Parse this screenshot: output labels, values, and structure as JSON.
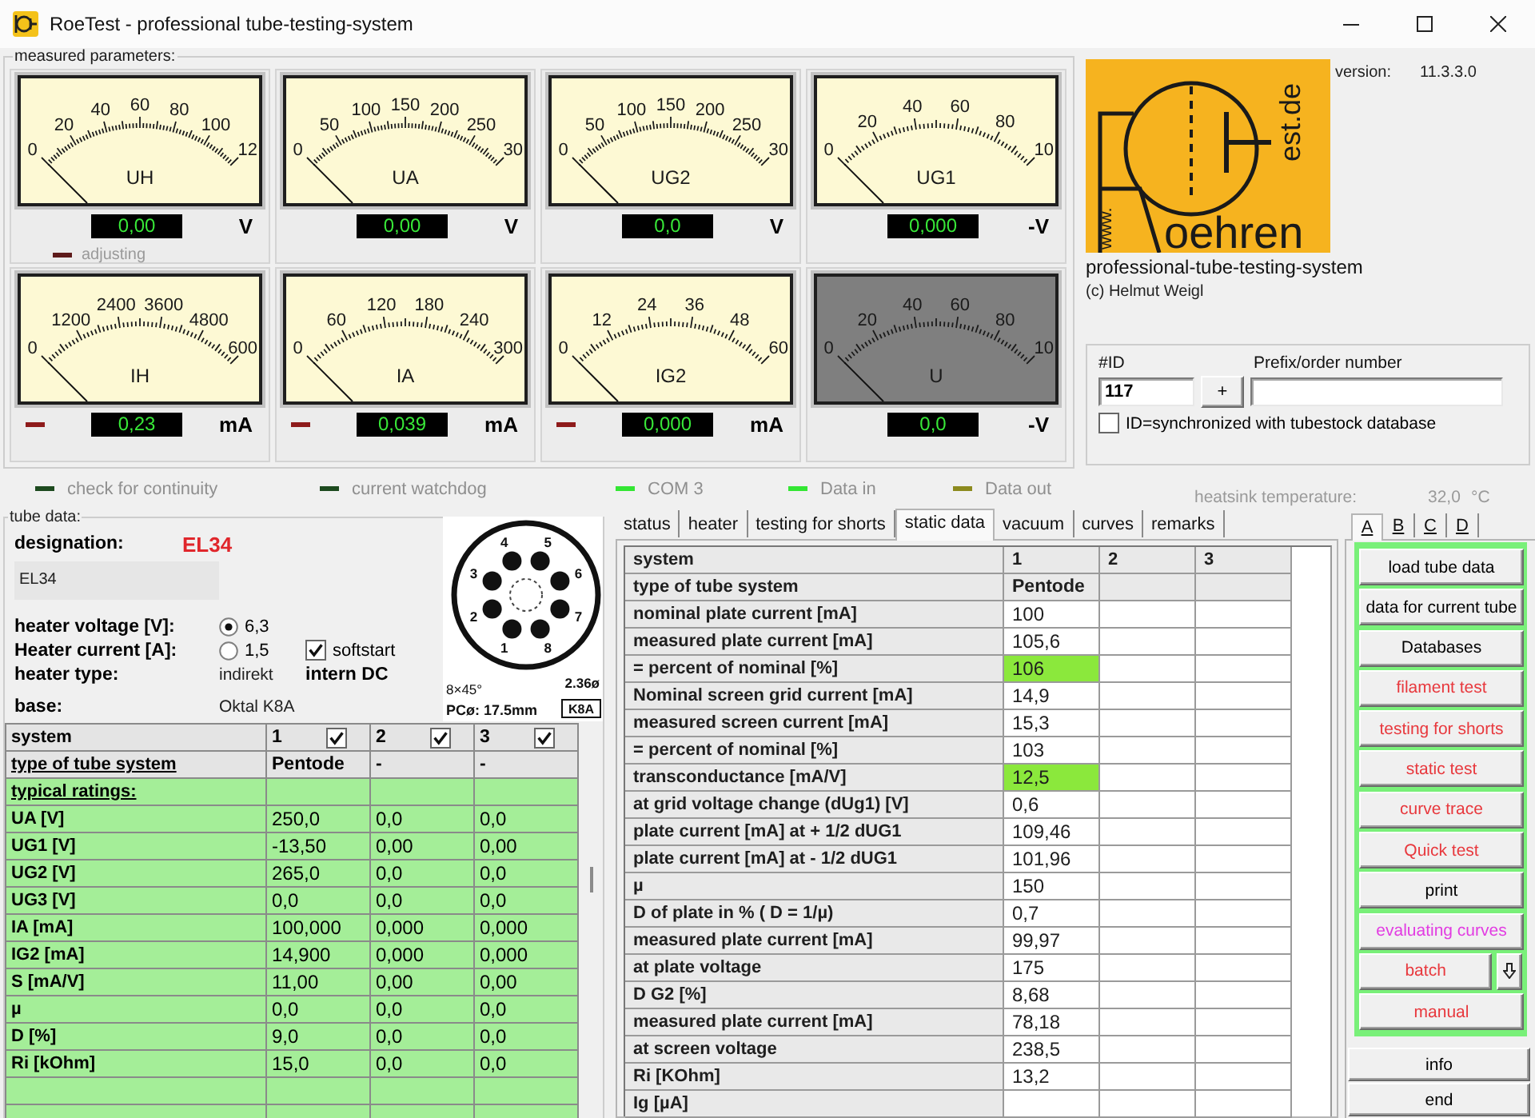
{
  "window": {
    "title": "RoeTest - professional tube-testing-system"
  },
  "meters": {
    "legend": "measured parameters:",
    "items": [
      {
        "name": "UH",
        "scale": [
          "0",
          "20",
          "40",
          "60",
          "80",
          "100",
          "12"
        ],
        "level": 0,
        "reading": "0,00",
        "unit": "V",
        "enabled": true,
        "led": {
          "label": "adjusting",
          "color": "#5e1b1b"
        }
      },
      {
        "name": "UA",
        "scale": [
          "0",
          "50",
          "100",
          "150",
          "200",
          "250",
          "30"
        ],
        "level": 0,
        "reading": "0,00",
        "unit": "V",
        "enabled": true
      },
      {
        "name": "UG2",
        "scale": [
          "0",
          "50",
          "100",
          "150",
          "200",
          "250",
          "30"
        ],
        "level": 0,
        "reading": "0,0",
        "unit": "V",
        "enabled": true
      },
      {
        "name": "UG1",
        "scale": [
          "0",
          "20",
          "40",
          "60",
          "80",
          "10"
        ],
        "level": 0,
        "reading": "0,000",
        "unit": "-V",
        "enabled": true
      },
      {
        "name": "IH",
        "scale": [
          "0",
          "1200",
          "2400",
          "3600",
          "4800",
          "600"
        ],
        "level": 0,
        "reading": "0,23",
        "unit": "mA",
        "enabled": true,
        "led": {
          "color": "#8e1b1b"
        }
      },
      {
        "name": "IA",
        "scale": [
          "0",
          "60",
          "120",
          "180",
          "240",
          "300"
        ],
        "level": 0,
        "reading": "0,039",
        "unit": "mA",
        "enabled": true,
        "led": {
          "color": "#8e1b1b"
        }
      },
      {
        "name": "IG2",
        "scale": [
          "0",
          "12",
          "24",
          "36",
          "48",
          "60"
        ],
        "level": 0,
        "reading": "0,000",
        "unit": "mA",
        "enabled": true,
        "led": {
          "color": "#8e1b1b"
        }
      },
      {
        "name": "U",
        "scale": [
          "0",
          "20",
          "40",
          "60",
          "80",
          "10"
        ],
        "level": 0,
        "reading": "0,0",
        "unit": "-V",
        "enabled": false
      }
    ]
  },
  "status_lights": [
    {
      "label": "check for continuity",
      "color": "#1d4a1f"
    },
    {
      "label": "current watchdog",
      "color": "#1d4a1f"
    },
    {
      "label": "COM 3",
      "color": "#33e633"
    },
    {
      "label": "Data in",
      "color": "#33e633"
    },
    {
      "label": "Data out",
      "color": "#8c8a1e"
    }
  ],
  "about": {
    "logo": {
      "side_text": "www.",
      "word": "oehren",
      "tail_text": "est.de"
    },
    "version_label": "version:",
    "version": "11.3.3.0",
    "subtitle": "professional-tube-testing-system",
    "copyright": "(c) Helmut Weigl"
  },
  "order": {
    "id_label": "#ID",
    "id_value": "117",
    "add_button": "+",
    "prefix_label": "Prefix/order number",
    "sync": {
      "label": "ID=synchronized with tubestock database",
      "checked": false
    }
  },
  "heatsink": {
    "label": "heatsink temperature:",
    "value": "32,0",
    "unit": "°C"
  },
  "tube_data": {
    "legend": "tube data:",
    "designation_label": "designation:",
    "designation": "EL34",
    "description": "EL34",
    "heater_voltage": {
      "label": "heater voltage [V]:",
      "option": "6,3",
      "selected": true
    },
    "heater_current": {
      "label": "Heater current [A]:",
      "option": "1,5",
      "selected": false
    },
    "softstart": {
      "label": "softstart",
      "checked": true
    },
    "heater_type": {
      "label": "heater type:",
      "value": "indirekt",
      "supply": "intern DC"
    },
    "base": {
      "label": "base:",
      "value": "Oktal K8A"
    },
    "base_diagram": {
      "pins": [
        "1",
        "2",
        "3",
        "4",
        "5",
        "6",
        "7",
        "8"
      ],
      "pin_spacing": "8×45°",
      "pin_size": "2.36ø",
      "pitch_circle": "PCø: 17.5mm",
      "code": "K8A"
    },
    "ratings": {
      "columns": [
        {
          "label": "system"
        },
        {
          "label": "1",
          "checked": true
        },
        {
          "label": "2",
          "checked": true
        },
        {
          "label": "3",
          "checked": true
        }
      ],
      "rows": [
        {
          "kind": "type",
          "label": "type of tube system",
          "values": [
            "Pentode",
            "-",
            "-"
          ]
        },
        {
          "kind": "section",
          "label": "typical ratings:"
        },
        {
          "kind": "value",
          "label": "UA [V]",
          "values": [
            "250,0",
            "0,0",
            "0,0"
          ]
        },
        {
          "kind": "value",
          "label": "UG1 [V]",
          "values": [
            "-13,50",
            "0,00",
            "0,00"
          ]
        },
        {
          "kind": "value",
          "label": "UG2 [V]",
          "values": [
            "265,0",
            "0,0",
            "0,0"
          ]
        },
        {
          "kind": "value",
          "label": "UG3 [V]",
          "values": [
            "0,0",
            "0,0",
            "0,0"
          ]
        },
        {
          "kind": "value",
          "label": "IA [mA]",
          "values": [
            "100,000",
            "0,000",
            "0,000"
          ]
        },
        {
          "kind": "value",
          "label": "IG2 [mA]",
          "values": [
            "14,900",
            "0,000",
            "0,000"
          ]
        },
        {
          "kind": "value",
          "label": "S [mA/V]",
          "values": [
            "11,00",
            "0,00",
            "0,00"
          ]
        },
        {
          "kind": "value",
          "label": "µ",
          "values": [
            "0,0",
            "0,0",
            "0,0"
          ]
        },
        {
          "kind": "value",
          "label": "D [%]",
          "values": [
            "9,0",
            "0,0",
            "0,0"
          ]
        },
        {
          "kind": "value",
          "label": "Ri [kOhm]",
          "values": [
            "15,0",
            "0,0",
            "0,0"
          ]
        }
      ]
    }
  },
  "test_tabs": [
    {
      "label": "status",
      "selected": false
    },
    {
      "label": "heater",
      "selected": false
    },
    {
      "label": "testing for shorts",
      "selected": false
    },
    {
      "label": "static data",
      "selected": true
    },
    {
      "label": "vacuum",
      "selected": false
    },
    {
      "label": "curves",
      "selected": false
    },
    {
      "label": "remarks",
      "selected": false
    }
  ],
  "static_data": {
    "columns": [
      "system",
      "1",
      "2",
      "3"
    ],
    "rows": [
      {
        "kind": "type",
        "label": "type of tube system",
        "values": [
          "Pentode"
        ]
      },
      {
        "kind": "value",
        "label": "nominal plate current [mA]",
        "values": [
          "100"
        ],
        "highlight": false
      },
      {
        "kind": "value",
        "label": "measured plate current [mA]",
        "values": [
          "105,6"
        ],
        "highlight": false
      },
      {
        "kind": "value",
        "label": "= percent of nominal [%]",
        "values": [
          "106"
        ],
        "highlight": true
      },
      {
        "kind": "value",
        "label": "Nominal screen grid current [mA]",
        "values": [
          "14,9"
        ],
        "highlight": false
      },
      {
        "kind": "value",
        "label": "measured screen current [mA]",
        "values": [
          "15,3"
        ],
        "highlight": false
      },
      {
        "kind": "value",
        "label": "= percent of nominal [%]",
        "values": [
          "103"
        ],
        "highlight": false
      },
      {
        "kind": "value",
        "label": "transconductance [mA/V]",
        "values": [
          "12,5"
        ],
        "highlight": true
      },
      {
        "kind": "value",
        "label": "at grid voltage change (dUg1) [V]",
        "values": [
          "0,6"
        ],
        "highlight": false
      },
      {
        "kind": "value",
        "label": "plate current [mA] at + 1/2 dUG1",
        "values": [
          "109,46"
        ],
        "highlight": false
      },
      {
        "kind": "value",
        "label": "plate current [mA] at - 1/2 dUG1",
        "values": [
          "101,96"
        ],
        "highlight": false
      },
      {
        "kind": "value",
        "label": "µ",
        "values": [
          "150"
        ],
        "highlight": false
      },
      {
        "kind": "value",
        "label": "D of plate in % ( D = 1/µ)",
        "values": [
          "0,7"
        ],
        "highlight": false
      },
      {
        "kind": "value",
        "label": "measured plate current [mA]",
        "values": [
          "99,97"
        ],
        "highlight": false
      },
      {
        "kind": "value",
        "label": "at plate voltage",
        "values": [
          "175"
        ],
        "highlight": false
      },
      {
        "kind": "value",
        "label": "D G2 [%]",
        "values": [
          "8,68"
        ],
        "highlight": false
      },
      {
        "kind": "value",
        "label": "measured plate current [mA]",
        "values": [
          "78,18"
        ],
        "highlight": false
      },
      {
        "kind": "value",
        "label": "at screen voltage",
        "values": [
          "238,5"
        ],
        "highlight": false
      },
      {
        "kind": "value",
        "label": "Ri [KOhm]",
        "values": [
          "13,2"
        ],
        "highlight": false
      },
      {
        "kind": "value",
        "label": "Ig [µA]",
        "highlight": false
      }
    ]
  },
  "side_tabs": [
    {
      "label": "A",
      "selected": true
    },
    {
      "label": "B",
      "selected": false
    },
    {
      "label": "C",
      "selected": false
    },
    {
      "label": "D",
      "selected": false
    }
  ],
  "actions": [
    {
      "label": "load tube data",
      "color": "#000000",
      "kind": "plain"
    },
    {
      "label": "data for current tube",
      "color": "#000000",
      "kind": "plain"
    },
    {
      "label": "Databases",
      "color": "#000000",
      "kind": "plain"
    },
    {
      "label": "filament test",
      "color": "#e8383d",
      "kind": "plain"
    },
    {
      "label": "testing for shorts",
      "color": "#e8383d",
      "kind": "plain"
    },
    {
      "label": "static test",
      "color": "#e8383d",
      "kind": "plain"
    },
    {
      "label": "curve trace",
      "color": "#e8383d",
      "kind": "plain"
    },
    {
      "label": "Quick test",
      "color": "#e8383d",
      "kind": "plain"
    },
    {
      "label": "print",
      "color": "#000000",
      "kind": "plain"
    },
    {
      "label": "evaluating curves",
      "color": "#e23ce2",
      "kind": "plain"
    },
    {
      "label": "batch",
      "color": "#e8383d",
      "kind": "split"
    },
    {
      "label": "manual",
      "color": "#e8383d",
      "kind": "plain"
    }
  ],
  "footer_buttons": [
    {
      "label": "info"
    },
    {
      "label": "end"
    }
  ]
}
